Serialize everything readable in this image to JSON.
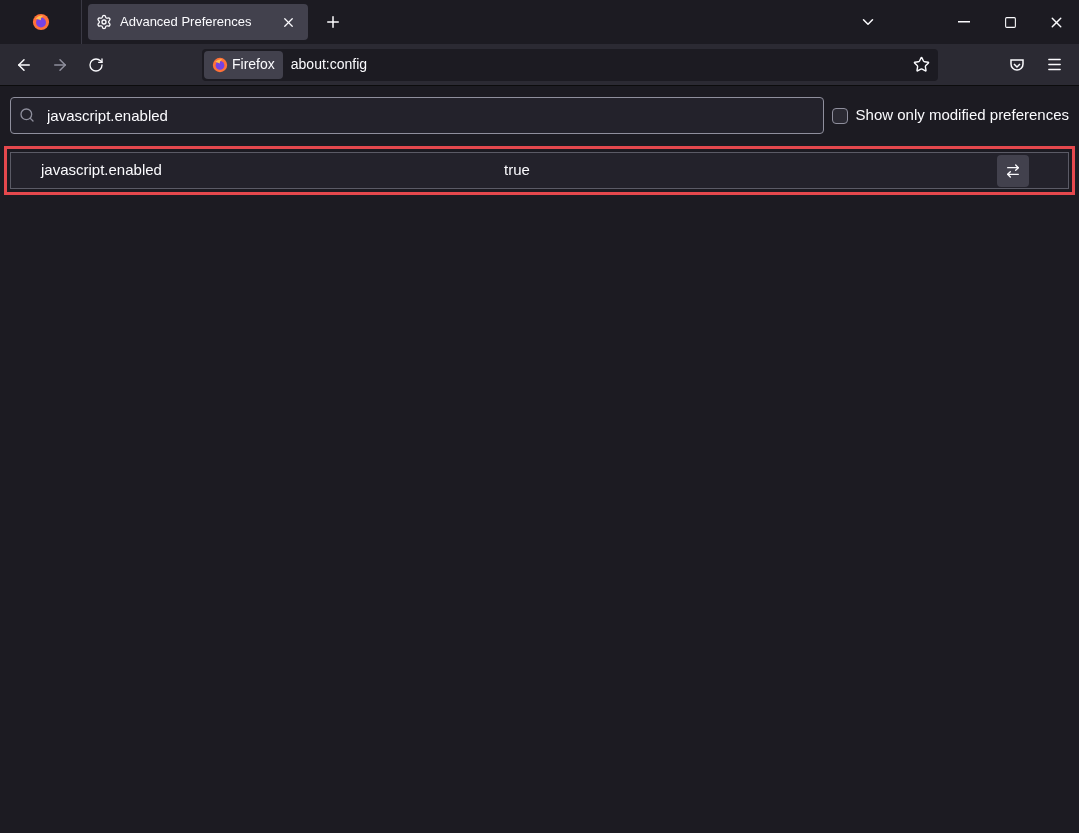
{
  "tabs": [
    {
      "title": "Advanced Preferences",
      "selected": true
    }
  ],
  "toolbar": {
    "identity_label": "Firefox",
    "url": "about:config"
  },
  "search": {
    "value": "javascript.enabled"
  },
  "modified_filter": {
    "label": "Show only modified preferences",
    "checked": false
  },
  "preferences": [
    {
      "name": "javascript.enabled",
      "value": "true",
      "highlighted": true
    }
  ]
}
